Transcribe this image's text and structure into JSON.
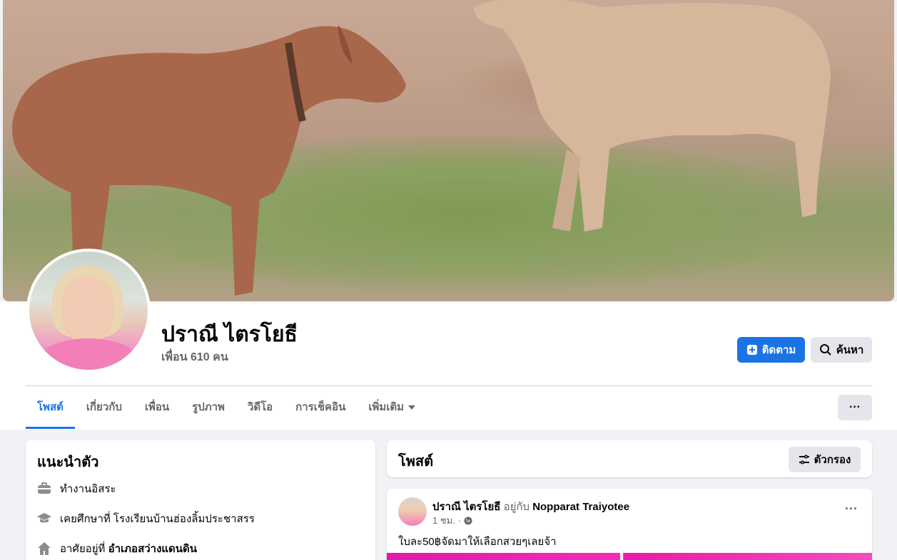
{
  "profile": {
    "name": "ปราณี ไตรโยธี",
    "friends": "เพื่อน 610 คน"
  },
  "actions": {
    "follow": "ติดตาม",
    "search": "ค้นหา",
    "more": "···"
  },
  "tabs": [
    {
      "label": "โพสต์",
      "active": true
    },
    {
      "label": "เกี่ยวกับ"
    },
    {
      "label": "เพื่อน"
    },
    {
      "label": "รูปภาพ"
    },
    {
      "label": "วิดีโอ"
    },
    {
      "label": "การเช็คอิน"
    },
    {
      "label": "เพิ่มเติม"
    }
  ],
  "intro": {
    "title": "แนะนำตัว",
    "work": "ทำงานอิสระ",
    "study": "เคยศึกษาที่ โรงเรียนบ้านฮ่องลิ้มประชาสรร",
    "lives_prefix": "อาศัยอยู่ที่ ",
    "lives_place": "อำเภอสว่างแดนดิน"
  },
  "posts": {
    "title": "โพสต์",
    "filter": "ตัวกรอง"
  },
  "post": {
    "author": "ปราณี ไตรโยธี",
    "with": " อยู่กับ ",
    "tagged": "Nopparat Traiyotee",
    "time": "1 ชม. ·",
    "text": "ใบละ50฿จัดมาให้เลือกสวยๆเลยจ้า",
    "dots": "···"
  },
  "colors": {
    "accent": "#1b74e4",
    "muted": "#65676b",
    "bg": "#f0f2f5"
  }
}
